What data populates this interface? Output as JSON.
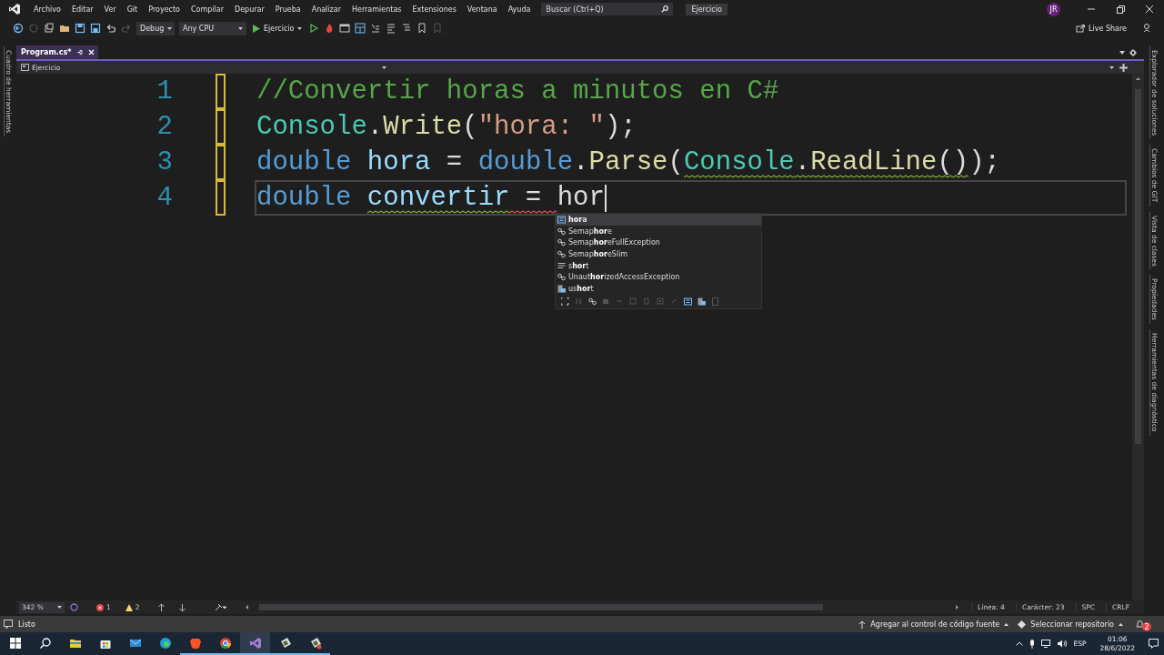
{
  "window": {
    "menu": [
      "Archivo",
      "Editar",
      "Ver",
      "Git",
      "Proyecto",
      "Compilar",
      "Depurar",
      "Prueba",
      "Analizar",
      "Herramientas",
      "Extensiones",
      "Ventana",
      "Ayuda"
    ],
    "search": {
      "placeholder": "Buscar (Ctrl+Q)"
    },
    "solution_name": "Ejercicio",
    "user_initials": "JR"
  },
  "toolbar": {
    "configuration": "Debug",
    "platform": "Any CPU",
    "start_target": "Ejercicio",
    "live_share": "Live Share"
  },
  "left_panel": {
    "label": "Cuadro de herramientas"
  },
  "right_panels": [
    "Explorador de soluciones",
    "Cambios de GIT",
    "Vista de clases",
    "Propiedades",
    "Herramientas de diagnóstico"
  ],
  "document_tabs": [
    {
      "label": "Program.cs*",
      "selected": true
    }
  ],
  "navigation": {
    "scope": "Ejercicio"
  },
  "editor": {
    "lines": [
      {
        "number": "1",
        "modified": true,
        "current": false,
        "tokens": [
          {
            "text": "//Convertir horas a minutos en C#",
            "kind": "comment"
          }
        ]
      },
      {
        "number": "2",
        "modified": true,
        "current": false,
        "tokens": [
          {
            "text": "Console",
            "kind": "type"
          },
          {
            "text": ".",
            "kind": "plain"
          },
          {
            "text": "Write",
            "kind": "method"
          },
          {
            "text": "(",
            "kind": "plain"
          },
          {
            "text": "\"hora: \"",
            "kind": "string"
          },
          {
            "text": ");",
            "kind": "plain"
          }
        ]
      },
      {
        "number": "3",
        "modified": true,
        "current": false,
        "tokens": [
          {
            "text": "double ",
            "kind": "keyword"
          },
          {
            "text": "hora",
            "kind": "variable"
          },
          {
            "text": " = ",
            "kind": "plain"
          },
          {
            "text": "double",
            "kind": "keyword"
          },
          {
            "text": ".",
            "kind": "plain"
          },
          {
            "text": "Parse",
            "kind": "method"
          },
          {
            "text": "(",
            "kind": "plain"
          },
          {
            "text": "Console",
            "kind": "type",
            "warning": true
          },
          {
            "text": ".",
            "kind": "plain",
            "warning": true
          },
          {
            "text": "ReadLine",
            "kind": "method",
            "warning": true
          },
          {
            "text": "()",
            "kind": "plain",
            "warning": true
          },
          {
            "text": ");",
            "kind": "plain"
          }
        ]
      },
      {
        "number": "4",
        "modified": true,
        "current": true,
        "tokens": [
          {
            "text": "double ",
            "kind": "keyword"
          },
          {
            "text": "convertir",
            "kind": "variable",
            "warning": true
          },
          {
            "text": " = ",
            "kind": "plain",
            "error": true
          },
          {
            "text": "hor",
            "kind": "plain"
          }
        ]
      }
    ],
    "completion": {
      "items": [
        {
          "label": "**hor**a",
          "kind": "field",
          "selected": true
        },
        {
          "label": "Semap**hor**e",
          "kind": "class",
          "selected": false
        },
        {
          "label": "Semap**hor**eFullException",
          "kind": "class",
          "selected": false
        },
        {
          "label": "Semap**hor**eSlim",
          "kind": "class",
          "selected": false
        },
        {
          "label": "s**hor**t",
          "kind": "keyword",
          "selected": false
        },
        {
          "label": "Unaut**hor**izedAccessException",
          "kind": "class",
          "selected": false
        },
        {
          "label": "us**hor**t",
          "kind": "struct",
          "selected": false
        }
      ]
    }
  },
  "editor_status": {
    "zoom": "342 %",
    "errors": "1",
    "warnings": "2",
    "line": "Línea: 4",
    "column": "Carácter: 23",
    "whitespace": "SPC",
    "line_ending": "CRLF"
  },
  "status_bar": {
    "message": "Listo",
    "source_control": "Agregar al control de código fuente",
    "repository": "Seleccionar repositorio",
    "notifications": "2"
  },
  "taskbar": {
    "apps": [
      {
        "kind": "explorer",
        "selected": false,
        "running": false
      },
      {
        "kind": "store",
        "selected": false,
        "running": false
      },
      {
        "kind": "mail",
        "selected": false,
        "running": false
      },
      {
        "kind": "edge",
        "selected": false,
        "running": false
      },
      {
        "kind": "brave",
        "selected": false,
        "running": true
      },
      {
        "kind": "chrome",
        "selected": false,
        "running": true
      },
      {
        "kind": "visualstudio",
        "selected": true,
        "running": true
      },
      {
        "kind": "app",
        "selected": false,
        "running": true
      },
      {
        "kind": "app2",
        "selected": false,
        "running": true
      }
    ],
    "language": "ESP",
    "time": "01:06",
    "date": "28/6/2022"
  }
}
